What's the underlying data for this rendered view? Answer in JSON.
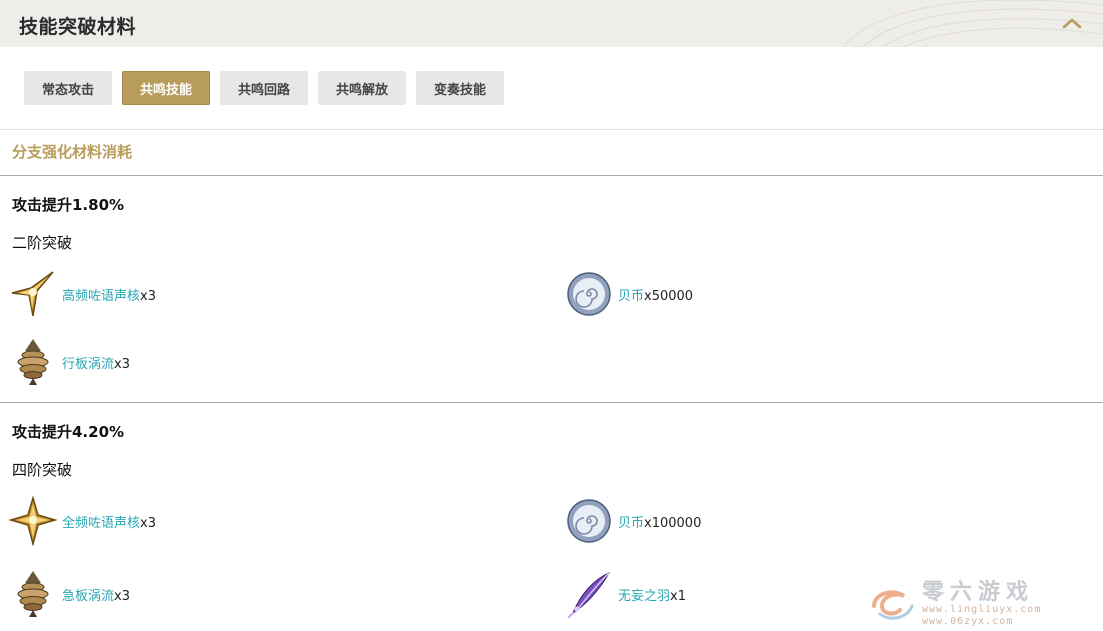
{
  "header": {
    "title": "技能突破材料",
    "collapse_icon": "chevron-up-icon"
  },
  "tabs": [
    {
      "label": "常态攻击",
      "active": false
    },
    {
      "label": "共鸣技能",
      "active": true
    },
    {
      "label": "共鸣回路",
      "active": false
    },
    {
      "label": "共鸣解放",
      "active": false
    },
    {
      "label": "变奏技能",
      "active": false
    }
  ],
  "section": {
    "heading": "分支强化材料消耗"
  },
  "groups": [
    {
      "title": "攻击提升1.80%",
      "stage": "二阶突破",
      "materials": [
        {
          "name": "高频咗语声核",
          "qty": "x3",
          "icon": "golden-star-core-icon"
        },
        {
          "name": "贝币",
          "qty": "x50000",
          "icon": "shell-coin-icon"
        },
        {
          "name": "行板涡流",
          "qty": "x3",
          "icon": "vortex-spiral-icon"
        }
      ]
    },
    {
      "title": "攻击提升4.20%",
      "stage": "四阶突破",
      "materials": [
        {
          "name": "全频咗语声核",
          "qty": "x3",
          "icon": "golden-star-core-icon"
        },
        {
          "name": "贝币",
          "qty": "x100000",
          "icon": "shell-coin-icon"
        },
        {
          "name": "急板涡流",
          "qty": "x3",
          "icon": "vortex-spiral-icon"
        },
        {
          "name": "无妄之羽",
          "qty": "x1",
          "icon": "purple-feather-icon"
        }
      ]
    }
  ],
  "watermark": {
    "cn": "零六游戏",
    "url1": "www.lingliuyx.com",
    "url2": "www.06zyx.com",
    "icon": "logo-swirl-icon"
  },
  "colors": {
    "accent": "#b89c5b",
    "link": "#27a6b3",
    "header_bg": "#efedea"
  }
}
